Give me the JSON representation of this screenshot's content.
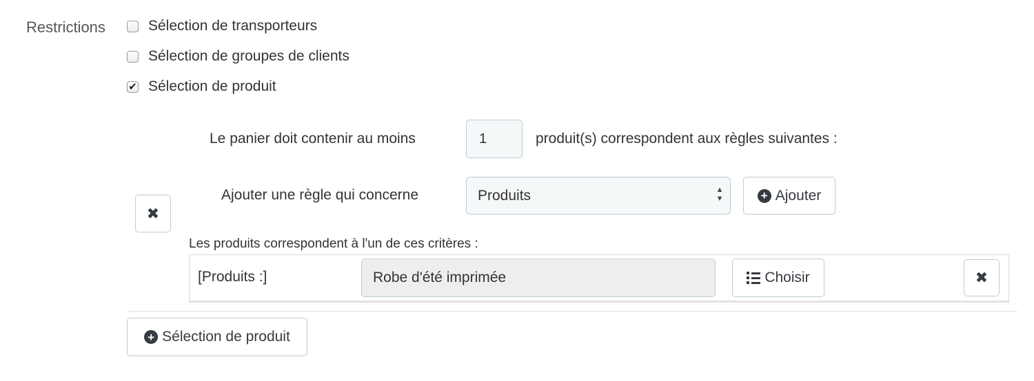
{
  "restrictions": {
    "label": "Restrictions",
    "options": [
      {
        "label": "Sélection de transporteurs",
        "checked": false,
        "check_glyph": ""
      },
      {
        "label": "Sélection de groupes de clients",
        "checked": false,
        "check_glyph": ""
      },
      {
        "label": "Sélection de produit",
        "checked": true,
        "check_glyph": "✔"
      }
    ]
  },
  "product_rule": {
    "prefix": "Le panier doit contenir au moins",
    "quantity": "1",
    "suffix": "produit(s) correspondent aux règles suivantes :",
    "add_rule_label": "Ajouter une règle qui concerne",
    "rule_type_selected": "Produits",
    "add_button_label": "Ajouter",
    "remove_group_glyph": "✖",
    "criteria_heading": "Les produits correspondent à l'un de ces critères :",
    "criteria_rows": [
      {
        "label": "[Produits :]",
        "value": "Robe d'été imprimée",
        "choose_button_label": "Choisir",
        "remove_glyph": "✖"
      }
    ]
  },
  "add_selection_button_label": "Sélection de produit",
  "icons": {
    "plus": "+",
    "select_up": "▲",
    "select_down": "▼"
  },
  "colors": {
    "border": "#bbcdd2",
    "field_bg": "#f5f8f9",
    "readonly_bg": "#eeeeee",
    "text": "#363a41"
  }
}
